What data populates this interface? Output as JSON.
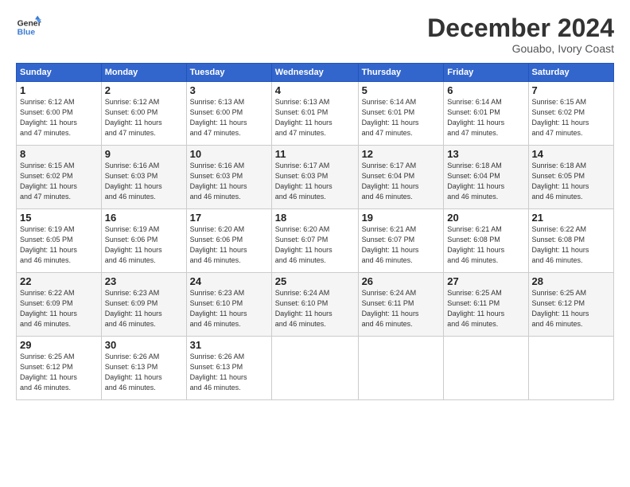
{
  "logo": {
    "line1": "General",
    "line2": "Blue"
  },
  "title": "December 2024",
  "subtitle": "Gouabo, Ivory Coast",
  "days_header": [
    "Sunday",
    "Monday",
    "Tuesday",
    "Wednesday",
    "Thursday",
    "Friday",
    "Saturday"
  ],
  "weeks": [
    [
      {
        "day": "1",
        "info": "Sunrise: 6:12 AM\nSunset: 6:00 PM\nDaylight: 11 hours\nand 47 minutes."
      },
      {
        "day": "2",
        "info": "Sunrise: 6:12 AM\nSunset: 6:00 PM\nDaylight: 11 hours\nand 47 minutes."
      },
      {
        "day": "3",
        "info": "Sunrise: 6:13 AM\nSunset: 6:00 PM\nDaylight: 11 hours\nand 47 minutes."
      },
      {
        "day": "4",
        "info": "Sunrise: 6:13 AM\nSunset: 6:01 PM\nDaylight: 11 hours\nand 47 minutes."
      },
      {
        "day": "5",
        "info": "Sunrise: 6:14 AM\nSunset: 6:01 PM\nDaylight: 11 hours\nand 47 minutes."
      },
      {
        "day": "6",
        "info": "Sunrise: 6:14 AM\nSunset: 6:01 PM\nDaylight: 11 hours\nand 47 minutes."
      },
      {
        "day": "7",
        "info": "Sunrise: 6:15 AM\nSunset: 6:02 PM\nDaylight: 11 hours\nand 47 minutes."
      }
    ],
    [
      {
        "day": "8",
        "info": "Sunrise: 6:15 AM\nSunset: 6:02 PM\nDaylight: 11 hours\nand 47 minutes."
      },
      {
        "day": "9",
        "info": "Sunrise: 6:16 AM\nSunset: 6:03 PM\nDaylight: 11 hours\nand 46 minutes."
      },
      {
        "day": "10",
        "info": "Sunrise: 6:16 AM\nSunset: 6:03 PM\nDaylight: 11 hours\nand 46 minutes."
      },
      {
        "day": "11",
        "info": "Sunrise: 6:17 AM\nSunset: 6:03 PM\nDaylight: 11 hours\nand 46 minutes."
      },
      {
        "day": "12",
        "info": "Sunrise: 6:17 AM\nSunset: 6:04 PM\nDaylight: 11 hours\nand 46 minutes."
      },
      {
        "day": "13",
        "info": "Sunrise: 6:18 AM\nSunset: 6:04 PM\nDaylight: 11 hours\nand 46 minutes."
      },
      {
        "day": "14",
        "info": "Sunrise: 6:18 AM\nSunset: 6:05 PM\nDaylight: 11 hours\nand 46 minutes."
      }
    ],
    [
      {
        "day": "15",
        "info": "Sunrise: 6:19 AM\nSunset: 6:05 PM\nDaylight: 11 hours\nand 46 minutes."
      },
      {
        "day": "16",
        "info": "Sunrise: 6:19 AM\nSunset: 6:06 PM\nDaylight: 11 hours\nand 46 minutes."
      },
      {
        "day": "17",
        "info": "Sunrise: 6:20 AM\nSunset: 6:06 PM\nDaylight: 11 hours\nand 46 minutes."
      },
      {
        "day": "18",
        "info": "Sunrise: 6:20 AM\nSunset: 6:07 PM\nDaylight: 11 hours\nand 46 minutes."
      },
      {
        "day": "19",
        "info": "Sunrise: 6:21 AM\nSunset: 6:07 PM\nDaylight: 11 hours\nand 46 minutes."
      },
      {
        "day": "20",
        "info": "Sunrise: 6:21 AM\nSunset: 6:08 PM\nDaylight: 11 hours\nand 46 minutes."
      },
      {
        "day": "21",
        "info": "Sunrise: 6:22 AM\nSunset: 6:08 PM\nDaylight: 11 hours\nand 46 minutes."
      }
    ],
    [
      {
        "day": "22",
        "info": "Sunrise: 6:22 AM\nSunset: 6:09 PM\nDaylight: 11 hours\nand 46 minutes."
      },
      {
        "day": "23",
        "info": "Sunrise: 6:23 AM\nSunset: 6:09 PM\nDaylight: 11 hours\nand 46 minutes."
      },
      {
        "day": "24",
        "info": "Sunrise: 6:23 AM\nSunset: 6:10 PM\nDaylight: 11 hours\nand 46 minutes."
      },
      {
        "day": "25",
        "info": "Sunrise: 6:24 AM\nSunset: 6:10 PM\nDaylight: 11 hours\nand 46 minutes."
      },
      {
        "day": "26",
        "info": "Sunrise: 6:24 AM\nSunset: 6:11 PM\nDaylight: 11 hours\nand 46 minutes."
      },
      {
        "day": "27",
        "info": "Sunrise: 6:25 AM\nSunset: 6:11 PM\nDaylight: 11 hours\nand 46 minutes."
      },
      {
        "day": "28",
        "info": "Sunrise: 6:25 AM\nSunset: 6:12 PM\nDaylight: 11 hours\nand 46 minutes."
      }
    ],
    [
      {
        "day": "29",
        "info": "Sunrise: 6:25 AM\nSunset: 6:12 PM\nDaylight: 11 hours\nand 46 minutes."
      },
      {
        "day": "30",
        "info": "Sunrise: 6:26 AM\nSunset: 6:13 PM\nDaylight: 11 hours\nand 46 minutes."
      },
      {
        "day": "31",
        "info": "Sunrise: 6:26 AM\nSunset: 6:13 PM\nDaylight: 11 hours\nand 46 minutes."
      },
      null,
      null,
      null,
      null
    ]
  ]
}
